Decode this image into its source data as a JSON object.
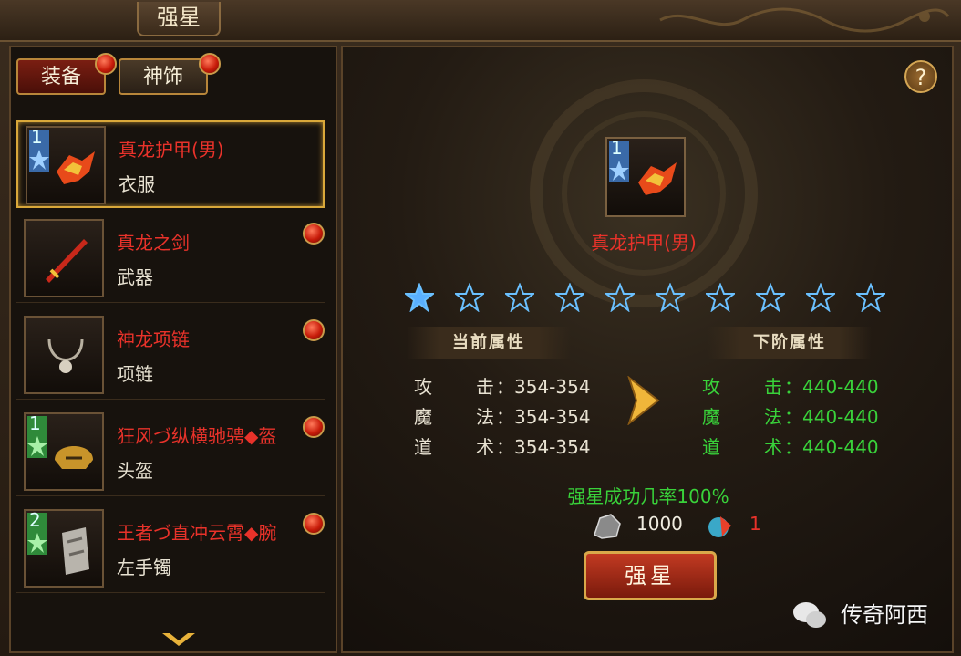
{
  "window": {
    "title": "强星"
  },
  "tabs": [
    {
      "label": "装备"
    },
    {
      "label": "神饰"
    }
  ],
  "items": [
    {
      "name": "真龙护甲(男)",
      "type": "衣服",
      "level": "1",
      "badge": "blue"
    },
    {
      "name": "真龙之剑",
      "type": "武器",
      "level": "",
      "badge": ""
    },
    {
      "name": "神龙项链",
      "type": "项链",
      "level": "",
      "badge": ""
    },
    {
      "name": "狂风づ纵横驰骋◆盔",
      "type": "头盔",
      "level": "1",
      "badge": "green"
    },
    {
      "name": "王者づ直冲云霄◆腕",
      "type": "左手镯",
      "level": "2",
      "badge": "green"
    }
  ],
  "selected": {
    "name": "真龙护甲(男)",
    "level": "1"
  },
  "stars": {
    "total": 10,
    "filled": 1
  },
  "help_label": "?",
  "current_attr": {
    "header": "当前属性",
    "rows": [
      {
        "k1": "攻",
        "k2": "击",
        "value": "：354-354"
      },
      {
        "k1": "魔",
        "k2": "法",
        "value": "：354-354"
      },
      {
        "k1": "道",
        "k2": "术",
        "value": "：354-354"
      }
    ]
  },
  "next_attr": {
    "header": "下阶属性",
    "rows": [
      {
        "k1": "攻",
        "k2": "击",
        "value": "：440-440"
      },
      {
        "k1": "魔",
        "k2": "法",
        "value": "：440-440"
      },
      {
        "k1": "道",
        "k2": "术",
        "value": "：440-440"
      }
    ]
  },
  "success_rate": "强星成功几率100%",
  "cost": {
    "gold": "1000",
    "stone": "1"
  },
  "action": {
    "label": "强星"
  },
  "watermark": "传奇阿西",
  "colors": {
    "red_text": "#e8322a",
    "green_text": "#39d23a",
    "gold_border": "#d9a83a"
  }
}
